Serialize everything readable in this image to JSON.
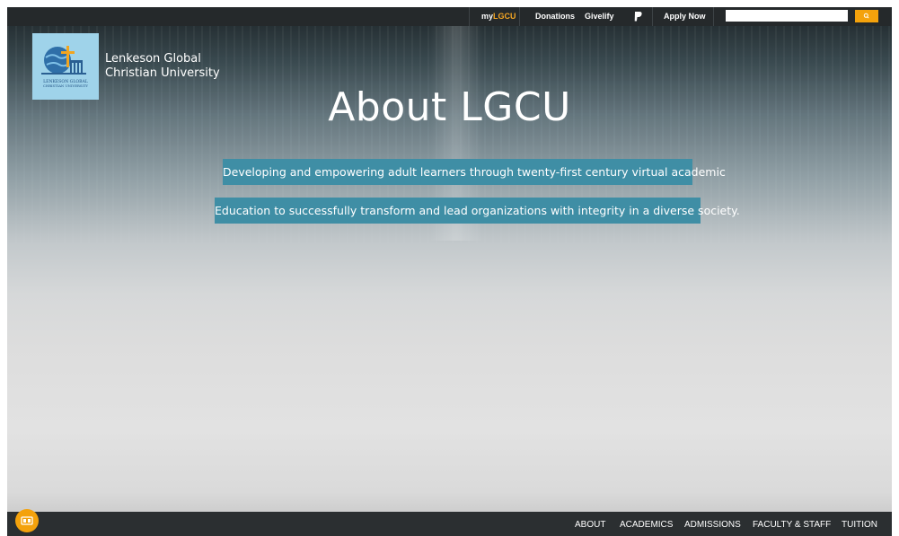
{
  "topbar": {
    "mylgcu_prefix": "my",
    "mylgcu_accent": "LGCU",
    "donations": "Donations",
    "givelify": "Givelify",
    "apply_now": "Apply Now",
    "search_placeholder": "",
    "search_button_icon": "search-icon"
  },
  "brand": {
    "name_line1": "Lenkeson Global",
    "name_line2": "Christian University",
    "logo_text_line1": "LENKESON GLOBAL",
    "logo_text_line2": "CHRISTIAN UNIVERSITY"
  },
  "hero": {
    "title": "About LGCU",
    "tagline1": "Developing and empowering adult learners through twenty-first century virtual academic",
    "tagline2": "Education to successfully transform and lead organizations with integrity in a diverse society."
  },
  "nav": {
    "items": [
      "ABOUT",
      "ACADEMICS",
      "ADMISSIONS",
      "FACULTY & STAFF",
      "TUITION"
    ]
  },
  "colors": {
    "accent": "#f5a623",
    "tagline_bg": "#3f8ea5",
    "bar_bg": "#25292b"
  }
}
